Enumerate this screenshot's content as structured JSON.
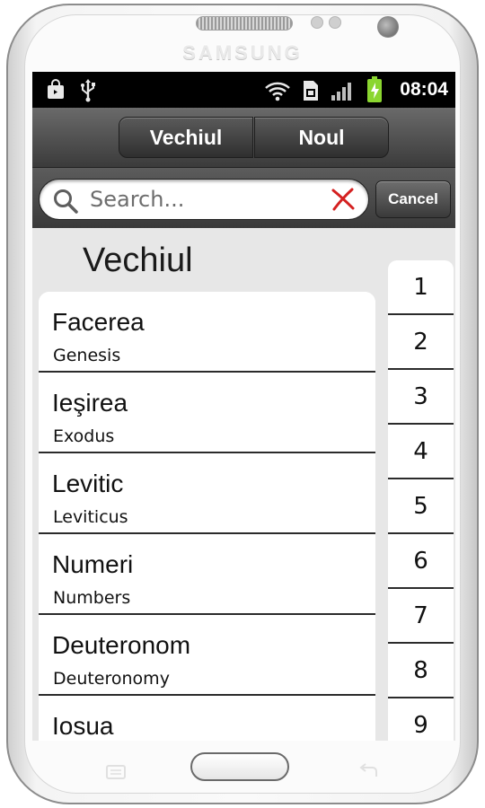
{
  "device": {
    "brand": "SAMSUNG"
  },
  "status_bar": {
    "time": "08:04",
    "icons": [
      "shopping-bag-icon",
      "usb-icon",
      "wifi-icon",
      "sim-card-icon",
      "signal-icon",
      "battery-charging-icon"
    ],
    "battery_color": "#8bd630"
  },
  "tabs": [
    {
      "label": "Vechiul",
      "selected": true
    },
    {
      "label": "Noul",
      "selected": false
    }
  ],
  "search": {
    "placeholder": "Search...",
    "value": "",
    "cancel_label": "Cancel"
  },
  "section_title": "Vechiul",
  "books": [
    {
      "title": "Facerea",
      "subtitle": "Genesis"
    },
    {
      "title": "Ieşirea",
      "subtitle": "Exodus"
    },
    {
      "title": "Levitic",
      "subtitle": "Leviticus"
    },
    {
      "title": "Numeri",
      "subtitle": "Numbers"
    },
    {
      "title": "Deuteronom",
      "subtitle": "Deuteronomy"
    },
    {
      "title": "Iosua",
      "subtitle": ""
    }
  ],
  "index": [
    "1",
    "2",
    "3",
    "4",
    "5",
    "6",
    "7",
    "8",
    "9"
  ],
  "colors": {
    "toolbar_dark": "#3b3b3b",
    "clear_x": "#d42020",
    "background": "#e7e7e7"
  }
}
